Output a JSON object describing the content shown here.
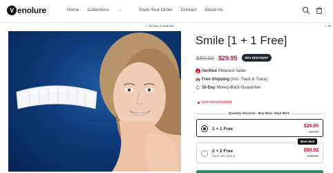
{
  "brand": {
    "logo_letter": "V",
    "logo_rest": "enolure"
  },
  "nav": {
    "items": [
      {
        "label": "Home"
      },
      {
        "label": "Collections"
      },
      {
        "label": "Track Your Order"
      },
      {
        "label": "Contact"
      },
      {
        "label": "About Us"
      }
    ]
  },
  "announcement": {
    "left": "✓ 30-Day Guarantee",
    "right": "✓ Se"
  },
  "product": {
    "title": "Smile [1 + 1 Free]",
    "old_price": "$60.00",
    "new_price": "$29.95",
    "discount_badge": "50% DISCOUNT",
    "features": [
      {
        "bold": "Verified",
        "rest": "Pinterest Seller",
        "icon": "pinterest-icon"
      },
      {
        "bold": "Free Shipping",
        "rest": "(incl. Track & Trace)",
        "icon": "truck-icon"
      },
      {
        "bold": "30-Day",
        "rest": "Money-Back Guarantee",
        "icon": "return-icon"
      }
    ],
    "stock_text": "Last Items Available",
    "quantity_heading": "Quantity Discount - Buy More, Save More",
    "options": [
      {
        "label": "1 + 1 Free",
        "sub": "",
        "price": "$29.95",
        "compare": "$60.00",
        "selected": true
      },
      {
        "label": "2 + 2 Free",
        "sub": "Save 25% Extra!",
        "price": "$50.92",
        "compare": "$120.00",
        "selected": false
      }
    ],
    "best_deal_label": "Best deal"
  },
  "colors": {
    "accent_red": "#c8102e",
    "badge_dark": "#1b2a33",
    "image_blue": "#0d3a78"
  }
}
